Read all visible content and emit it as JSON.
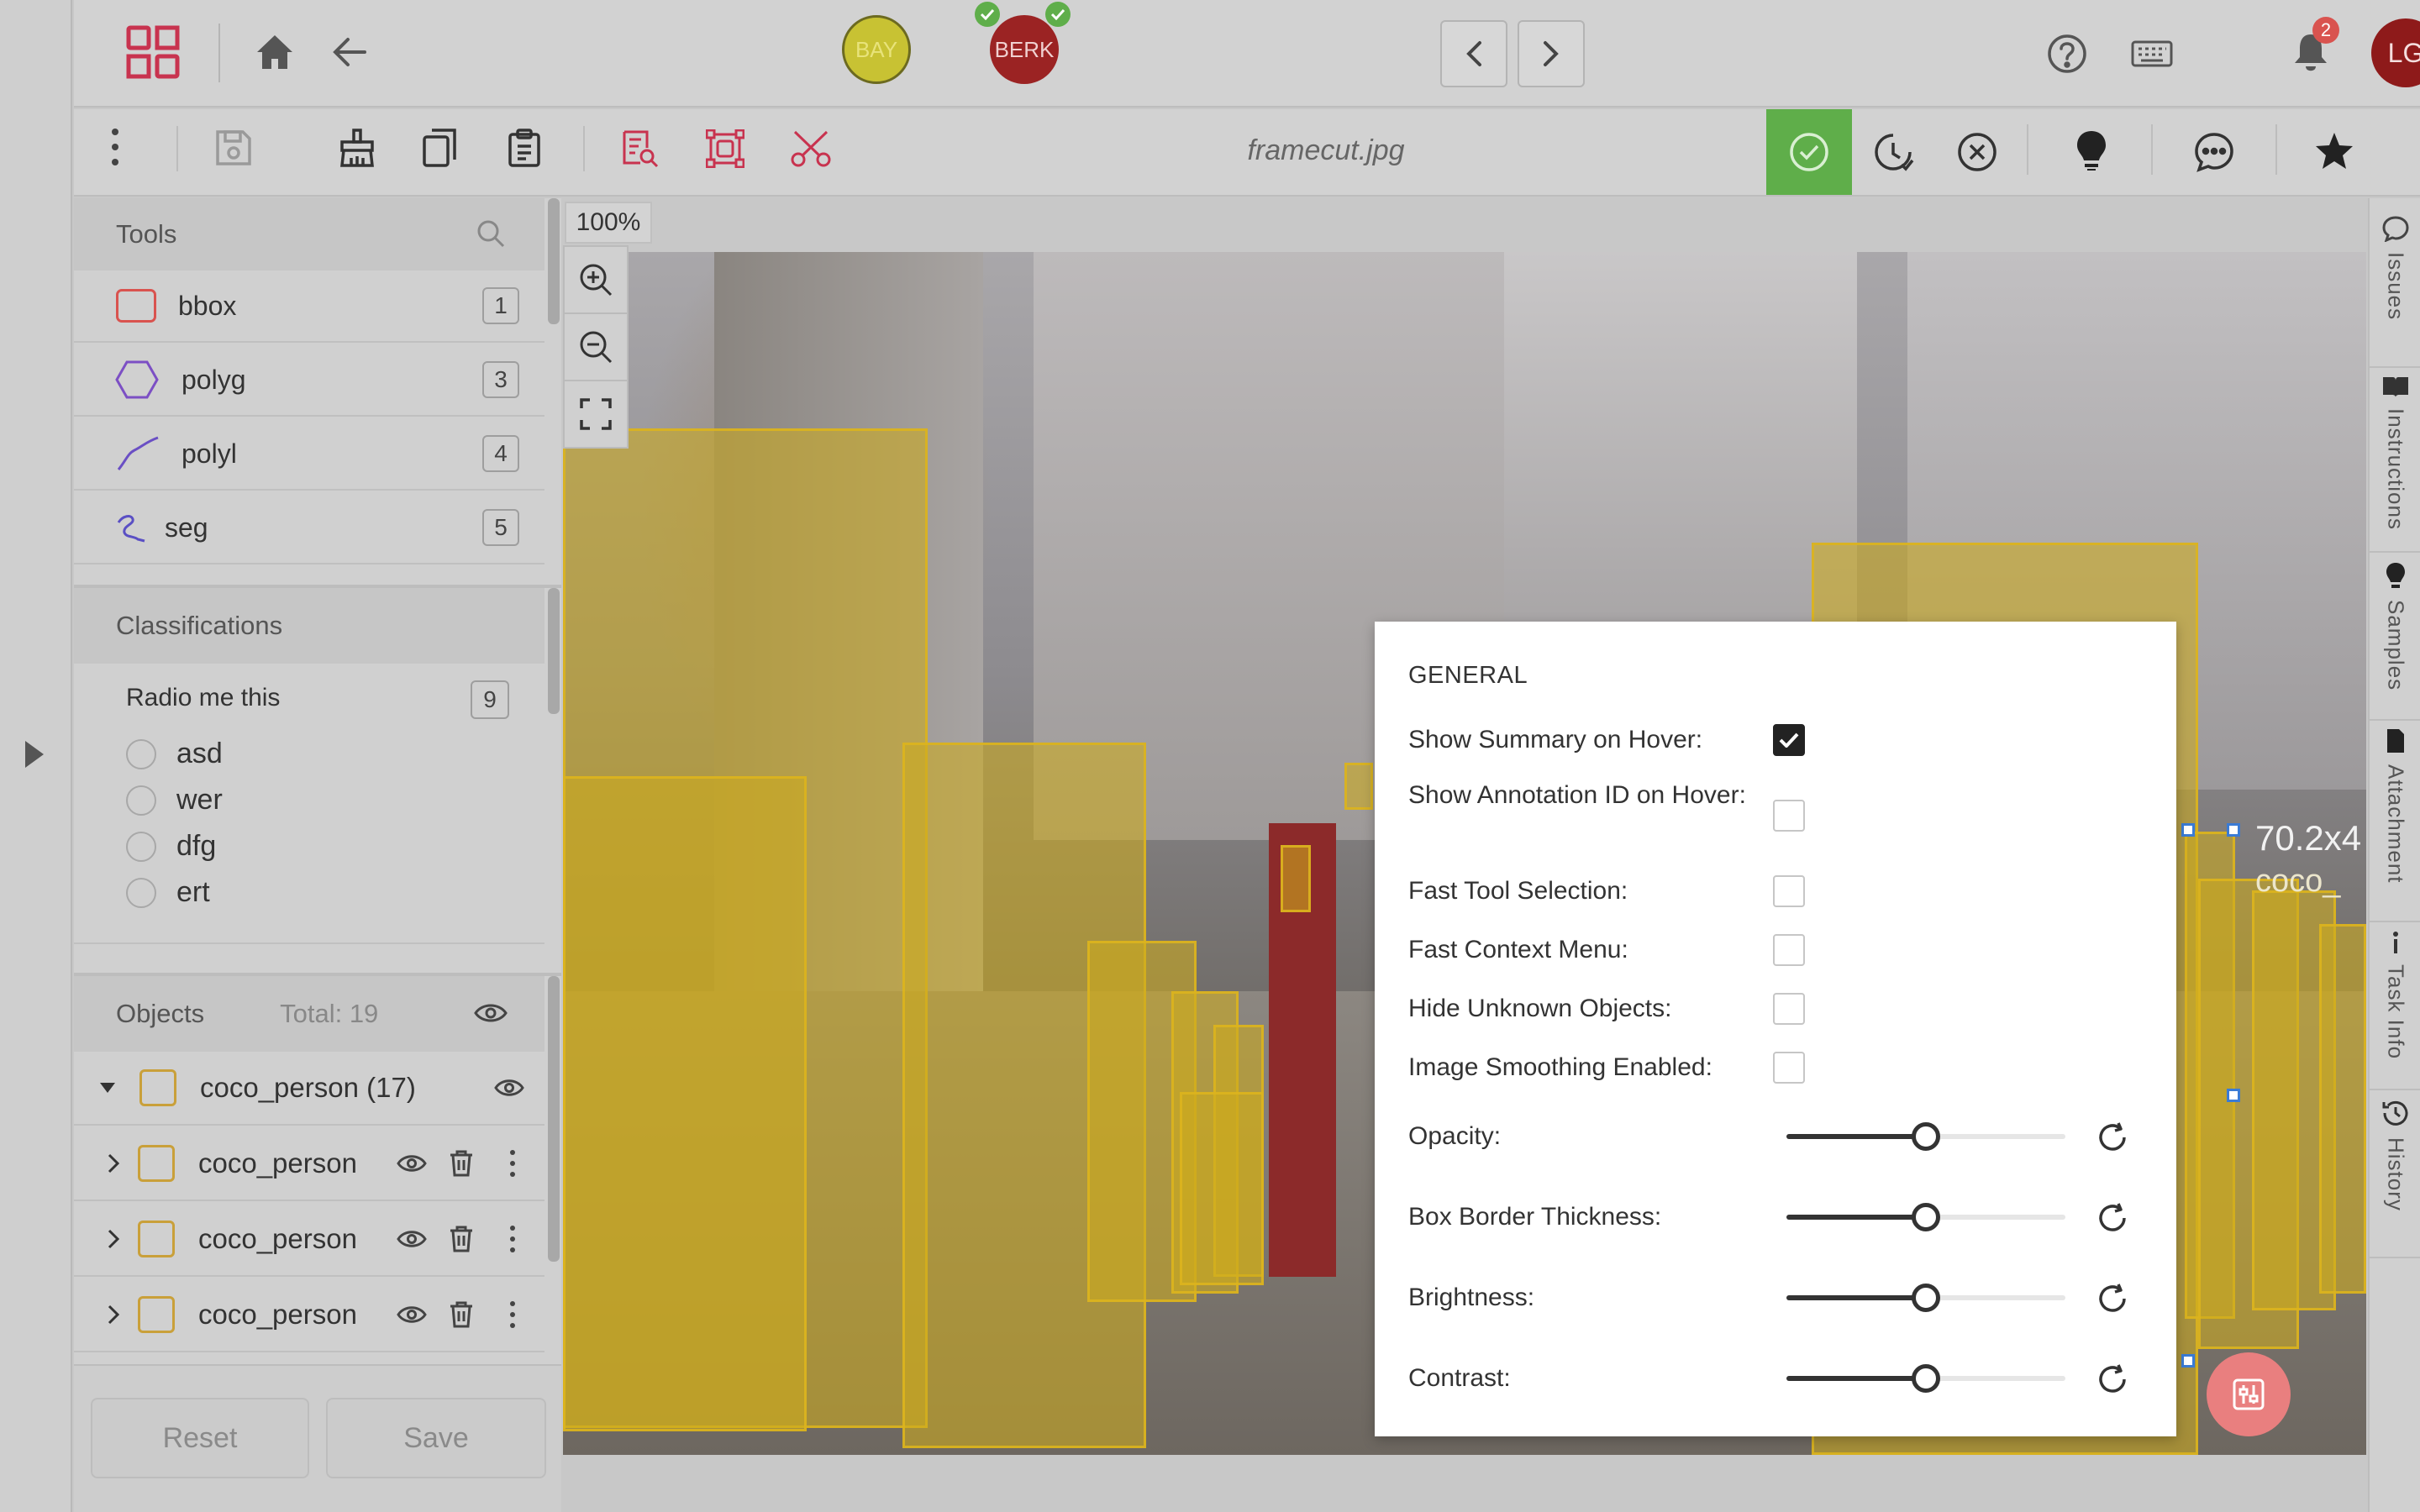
{
  "header": {
    "users": [
      {
        "initials": "BAY",
        "bg": "#c8c233"
      },
      {
        "initials": "BERK",
        "bg": "#9b2323"
      }
    ],
    "user_avatar": "LG",
    "notification_count": "2"
  },
  "toolbar": {
    "filename": "framecut.jpg",
    "accent": "#5fae4a"
  },
  "tools": {
    "title": "Tools",
    "items": [
      {
        "label": "bbox",
        "key": "1"
      },
      {
        "label": "polyg",
        "key": "3"
      },
      {
        "label": "polyl",
        "key": "4"
      },
      {
        "label": "seg",
        "key": "5"
      }
    ]
  },
  "classifications": {
    "title": "Classifications",
    "question": "Radio me this",
    "key": "9",
    "options": [
      "asd",
      "wer",
      "dfg",
      "ert"
    ]
  },
  "objects": {
    "title": "Objects",
    "total": "Total: 19",
    "group": "coco_person (17)",
    "items": [
      "coco_person",
      "coco_person",
      "coco_person"
    ]
  },
  "footer": {
    "reset": "Reset",
    "save": "Save"
  },
  "canvas": {
    "zoom": "100%",
    "box_label_dims": "70.2x4",
    "box_label_class": "coco_"
  },
  "right_tabs": [
    "Issues",
    "Instructions",
    "Samples",
    "Attachment",
    "Task Info",
    "History"
  ],
  "settings": {
    "heading": "GENERAL",
    "toggles": [
      {
        "label": "Show Summary on Hover:",
        "checked": true
      },
      {
        "label": "Show Annotation ID on Hover:",
        "checked": false
      },
      {
        "label": "Fast Tool Selection:",
        "checked": false
      },
      {
        "label": "Fast Context Menu:",
        "checked": false
      },
      {
        "label": "Hide Unknown Objects:",
        "checked": false
      },
      {
        "label": "Image Smoothing Enabled:",
        "checked": false
      }
    ],
    "sliders": [
      {
        "label": "Opacity:",
        "value": 0.5
      },
      {
        "label": "Box Border Thickness:",
        "value": 0.5
      },
      {
        "label": "Brightness:",
        "value": 0.5
      },
      {
        "label": "Contrast:",
        "value": 0.5
      }
    ]
  }
}
